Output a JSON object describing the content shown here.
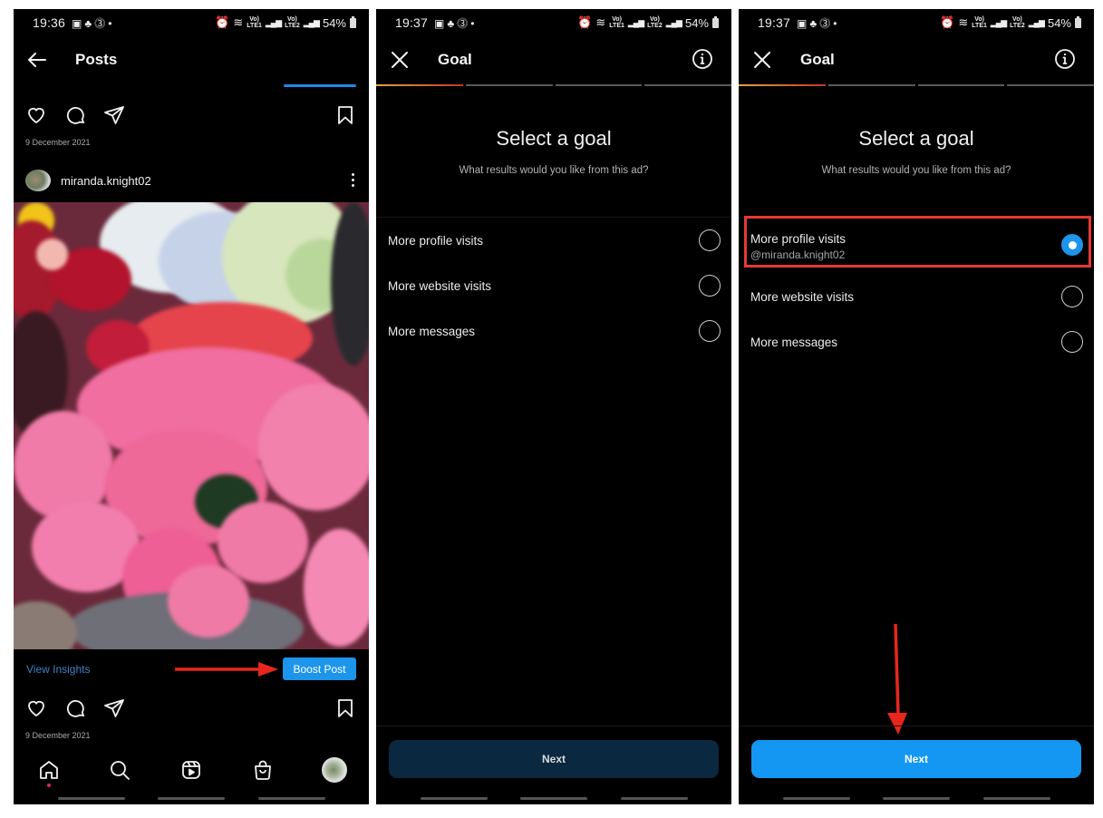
{
  "colors": {
    "accent_blue": "#1d95ea",
    "annotation_red": "#e53935",
    "background": "#000000",
    "link_blue": "#3d82c9"
  },
  "screens": [
    {
      "status": {
        "time": "19:36",
        "battery": "54%",
        "left_icons": [
          "gallery-icon",
          "notification-icon",
          "shield-icon",
          "dot"
        ],
        "right_icons": [
          "alarm-icon",
          "wifi-icon",
          "volte-lte1-signal",
          "volte-lte2-signal"
        ],
        "lte1": "Vo)) LTE1",
        "lte2": "Vo)) LTE2"
      },
      "header": {
        "title": "Posts",
        "back_icon": "arrow-left-icon"
      },
      "post_top": {
        "date": "9 December 2021"
      },
      "post": {
        "author": "miranda.knight02",
        "view_insights": "View Insights",
        "boost_post": "Boost Post",
        "date": "9 December 2021",
        "image_alt": "Bouquet of pink and red roses with white, green and blue hydrangeas"
      },
      "nav": [
        "home-icon",
        "search-icon",
        "reels-icon",
        "shop-icon",
        "profile-avatar"
      ]
    },
    {
      "status": {
        "time": "19:37",
        "battery": "54%"
      },
      "header": {
        "title": "Goal",
        "close_icon": "close-icon",
        "info_icon": "info-icon"
      },
      "progress_step": 1,
      "progress_total": 4,
      "title": "Select a goal",
      "subtitle": "What results would you like from this ad?",
      "options": [
        {
          "label": "More profile visits",
          "selected": false
        },
        {
          "label": "More website visits",
          "selected": false
        },
        {
          "label": "More messages",
          "selected": false
        }
      ],
      "next_label": "Next",
      "next_enabled": false
    },
    {
      "status": {
        "time": "19:37",
        "battery": "54%"
      },
      "header": {
        "title": "Goal",
        "close_icon": "close-icon",
        "info_icon": "info-icon"
      },
      "progress_step": 1,
      "progress_total": 4,
      "title": "Select a goal",
      "subtitle": "What results would you like from this ad?",
      "options": [
        {
          "label": "More profile visits",
          "sublabel": "@miranda.knight02",
          "selected": true
        },
        {
          "label": "More website visits",
          "selected": false
        },
        {
          "label": "More messages",
          "selected": false
        }
      ],
      "next_label": "Next",
      "next_enabled": true
    }
  ]
}
